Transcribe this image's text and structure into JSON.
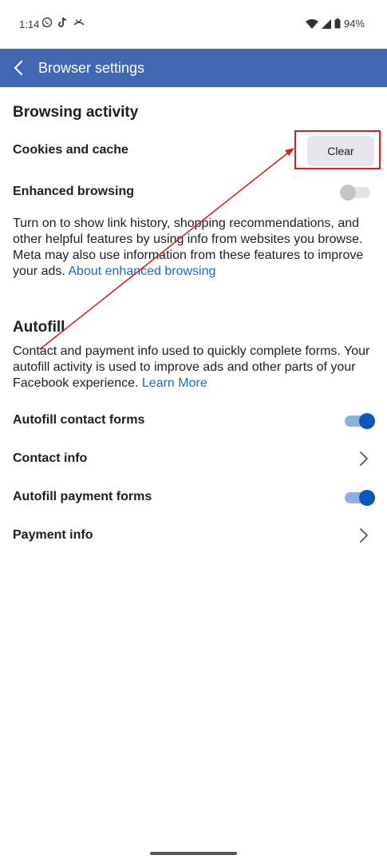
{
  "status_bar": {
    "time": "1:14",
    "battery": "94%"
  },
  "app_bar": {
    "title": "Browser settings",
    "back_icon": "chevron-left-icon"
  },
  "browsing_activity": {
    "title": "Browsing activity",
    "cookies_label": "Cookies and cache",
    "clear_label": "Clear",
    "enhanced_label": "Enhanced browsing",
    "enhanced_enabled": false,
    "description": "Turn on to show link history, shopping recommendations, and other helpful features by using info from websites you browse. Meta may also use information from these features to improve your ads.",
    "description_link": "About enhanced browsing"
  },
  "autofill": {
    "title": "Autofill",
    "description": "Contact and payment info used to quickly complete forms. Your autofill activity is used to improve ads and other parts of your Facebook experience.",
    "description_link": "Learn More",
    "rows": [
      {
        "label": "Autofill contact forms",
        "type": "toggle",
        "enabled": true
      },
      {
        "label": "Contact info",
        "type": "chevron"
      },
      {
        "label": "Autofill payment forms",
        "type": "toggle",
        "enabled": true
      },
      {
        "label": "Payment info",
        "type": "chevron"
      }
    ]
  },
  "colors": {
    "app_bar": "#4267b2",
    "link": "#1b6ac9",
    "toggle_on": "#0a58b5",
    "annotation": "#e01a1a"
  }
}
